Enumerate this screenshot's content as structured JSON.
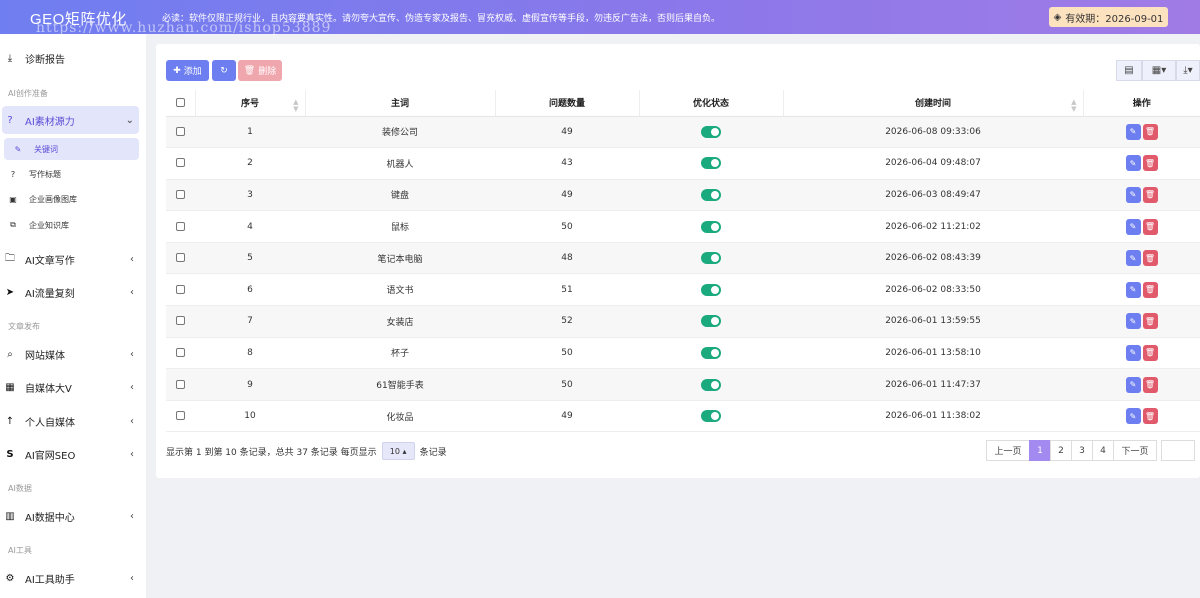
{
  "header": {
    "brand": "GEO矩阵优化",
    "notice": "必读：软件仅限正规行业，且内容要真实性。请勿夸大宣传、伪造专家及报告、冒充权威、虚假宣传等手段，勿违反广告法，否则后果自负。",
    "watermark": "https://www.huzhan.com/ishop53889",
    "expiry": "有效期：2026-09-01"
  },
  "sidebar": {
    "report": "诊断报告",
    "section_ai_create": "AI创作准备",
    "ai_material": "AI素材源力",
    "sub_items": [
      "关键词",
      "写作标题",
      "企业画像图库",
      "企业知识库"
    ],
    "ai_article": "AI文章写作",
    "ai_traffic": "AI流量复刻",
    "section_publish": "文章发布",
    "site_media": "网站媒体",
    "self_media_v": "自媒体大V",
    "personal_media": "个人自媒体",
    "ai_seo": "AI官网SEO",
    "section_data": "AI数据",
    "data_center": "AI数据中心",
    "section_tools": "AI工具",
    "tool_assistant": "AI工具助手"
  },
  "toolbar": {
    "add": "添加",
    "delete": "删除"
  },
  "table": {
    "headers": [
      "序号",
      "主词",
      "问题数量",
      "优化状态",
      "创建时间",
      "操作"
    ],
    "rows": [
      {
        "id": "1",
        "word": "装修公司",
        "count": "49",
        "enabled": true,
        "created": "2026-06-08 09:33:06"
      },
      {
        "id": "2",
        "word": "机器人",
        "count": "43",
        "enabled": true,
        "created": "2026-06-04 09:48:07"
      },
      {
        "id": "3",
        "word": "键盘",
        "count": "49",
        "enabled": true,
        "created": "2026-06-03 08:49:47"
      },
      {
        "id": "4",
        "word": "鼠标",
        "count": "50",
        "enabled": true,
        "created": "2026-06-02 11:21:02"
      },
      {
        "id": "5",
        "word": "笔记本电脑",
        "count": "48",
        "enabled": true,
        "created": "2026-06-02 08:43:39"
      },
      {
        "id": "6",
        "word": "语文书",
        "count": "51",
        "enabled": true,
        "created": "2026-06-02 08:33:50"
      },
      {
        "id": "7",
        "word": "女装店",
        "count": "52",
        "enabled": true,
        "created": "2026-06-01 13:59:55"
      },
      {
        "id": "8",
        "word": "杯子",
        "count": "50",
        "enabled": true,
        "created": "2026-06-01 13:58:10"
      },
      {
        "id": "9",
        "word": "61智能手表",
        "count": "50",
        "enabled": true,
        "created": "2026-06-01 11:47:37"
      },
      {
        "id": "10",
        "word": "化妆品",
        "count": "49",
        "enabled": true,
        "created": "2026-06-01 11:38:02"
      }
    ]
  },
  "pagination": {
    "info_prefix": "显示第 1 到第 10 条记录，总共 37 条记录 每页显示",
    "page_size": "10",
    "info_suffix": "条记录",
    "prev": "上一页",
    "pages": [
      "1",
      "2",
      "3",
      "4"
    ],
    "next": "下一页"
  },
  "colors": {
    "primary": "#6c7ef0",
    "toggle_on": "#1ba97e",
    "danger": "#e15a6b",
    "page_active": "#a28af0"
  }
}
